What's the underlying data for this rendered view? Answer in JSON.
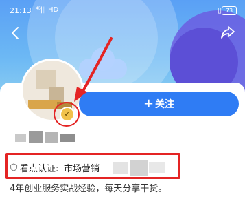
{
  "status_bar": {
    "time": "21:13",
    "signal": "⁴ᴳ|||",
    "network": "HD",
    "battery": "73"
  },
  "profile": {
    "follow_label": "关注",
    "follow_icon": "+",
    "badge_icon": "v-check-icon",
    "certification": {
      "label": "看点认证:",
      "value": "市场营销"
    },
    "bio": "4年创业服务实战经验，每天分享干货。"
  },
  "colors": {
    "accent": "#2f7cf4",
    "highlight": "#e42424",
    "badge": "#f1c24b"
  }
}
